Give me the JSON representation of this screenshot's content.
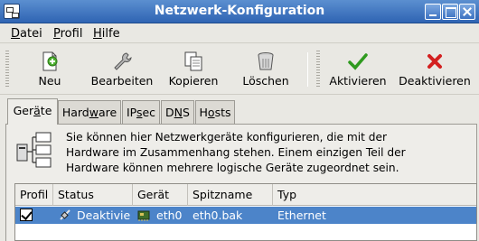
{
  "window": {
    "title": "Netzwerk-Konfiguration"
  },
  "menubar": {
    "items": [
      {
        "label": "Datei",
        "mnemonic": "D",
        "rest": "atei"
      },
      {
        "label": "Profil",
        "mnemonic": "P",
        "rest": "rofil"
      },
      {
        "label": "Hilfe",
        "mnemonic": "H",
        "rest": "ilfe"
      }
    ]
  },
  "toolbar": {
    "new_label": "Neu",
    "edit_label": "Bearbeiten",
    "copy_label": "Kopieren",
    "delete_label": "Löschen",
    "activate_label": "Aktivieren",
    "deactivate_label": "Deaktivieren",
    "icons": {
      "new": "new-file-icon",
      "edit": "wrench-icon",
      "copy": "copy-icon",
      "delete": "trash-icon",
      "activate": "checkmark-icon",
      "deactivate": "red-x-icon"
    }
  },
  "tabs": [
    {
      "label": "Geräte",
      "pre": "Ger",
      "u": "ä",
      "post": "te",
      "active": true
    },
    {
      "label": "Hardware",
      "pre": "Hard",
      "u": "w",
      "post": "are",
      "active": false
    },
    {
      "label": "IPsec",
      "pre": "IP",
      "u": "s",
      "post": "ec",
      "active": false
    },
    {
      "label": "DNS",
      "pre": "D",
      "u": "N",
      "post": "S",
      "active": false
    },
    {
      "label": "Hosts",
      "pre": "H",
      "u": "o",
      "post": "sts",
      "active": false
    }
  ],
  "info": {
    "line1": "Sie können hier Netzwerkgeräte konfigurieren, die mit der",
    "line2": "Hardware im Zusammenhang stehen. Einem einzigen Teil der",
    "line3": "Hardware können mehrere logische Geräte zugeordnet sein."
  },
  "table": {
    "columns": [
      "Profil",
      "Status",
      "Gerät",
      "Spitzname",
      "Typ"
    ],
    "rows": [
      {
        "profil_checked": true,
        "status": "Deaktiviert",
        "geraet": "eth0",
        "spitzname": "eth0.bak",
        "typ": "Ethernet"
      }
    ]
  },
  "colors": {
    "titlebar": "#3a70bd",
    "selection": "#4c84c9",
    "window_bg": "#e9e8e3"
  }
}
